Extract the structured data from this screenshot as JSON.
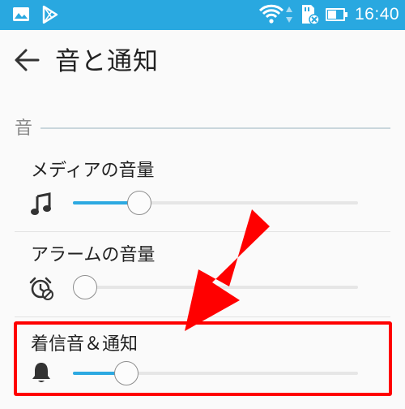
{
  "status_bar": {
    "time": "16:40",
    "battery_level": 0.48
  },
  "header": {
    "title": "音と通知"
  },
  "section": {
    "label": "音"
  },
  "settings": [
    {
      "title": "メディアの音量",
      "icon": "music-note-icon",
      "level": 0.2
    },
    {
      "title": "アラームの音量",
      "icon": "alarm-icon",
      "level": 0.0
    },
    {
      "title": "着信音＆通知",
      "icon": "bell-icon",
      "level": 0.15
    }
  ],
  "colors": {
    "accent": "#2ca9e1",
    "status_bar": "#29a8e0",
    "annotation": "#ff0000"
  }
}
